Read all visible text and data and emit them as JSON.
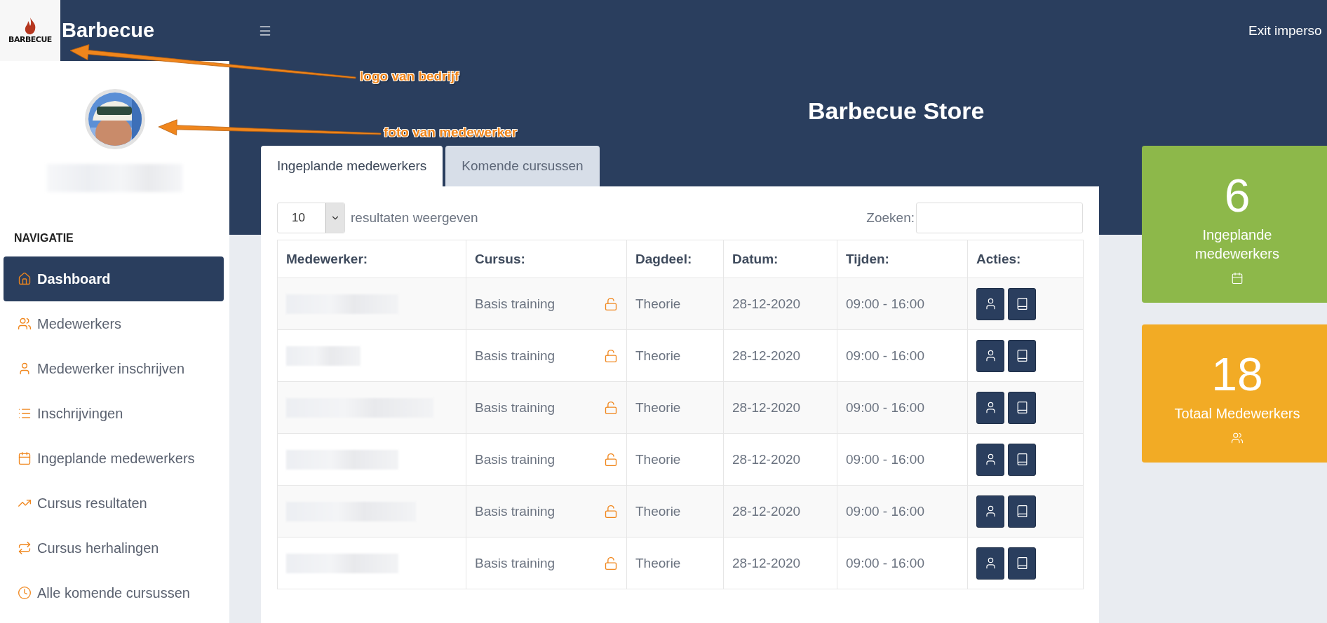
{
  "topbar": {
    "logo_text": "BARBECUE",
    "brand": "Barbecue",
    "exit_link": "Exit imperso"
  },
  "annotations": [
    {
      "label": "logo van bedrijf"
    },
    {
      "label": "foto van medewerker"
    }
  ],
  "sidebar": {
    "section_title": "NAVIGATIE",
    "items": [
      {
        "label": "Dashboard",
        "kind": "home",
        "selected": true
      },
      {
        "label": "Medewerkers",
        "kind": "users",
        "selected": false
      },
      {
        "label": "Medewerker inschrijven",
        "kind": "user",
        "selected": false
      },
      {
        "label": "Inschrijvingen",
        "kind": "list",
        "selected": false
      },
      {
        "label": "Ingeplande medewerkers",
        "kind": "calendar",
        "selected": false
      },
      {
        "label": "Cursus resultaten",
        "kind": "chart",
        "selected": false
      },
      {
        "label": "Cursus herhalingen",
        "kind": "repeat",
        "selected": false
      },
      {
        "label": "Alle komende cursussen",
        "kind": "clock",
        "selected": false
      }
    ]
  },
  "page_title": "Barbecue Store",
  "tabs": [
    {
      "label": "Ingeplande medewerkers",
      "selected": true
    },
    {
      "label": "Komende cursussen",
      "selected": false
    }
  ],
  "table_controls": {
    "page_size": "10",
    "page_size_suffix": "resultaten weergeven",
    "search_label": "Zoeken:"
  },
  "table": {
    "columns": [
      "Medewerker:",
      "Cursus:",
      "Dagdeel:",
      "Datum:",
      "Tijden:",
      "Acties:"
    ],
    "rows": [
      {
        "course": "Basis training",
        "part": "Theorie",
        "date": "28-12-2020",
        "times": "09:00 - 16:00"
      },
      {
        "course": "Basis training",
        "part": "Theorie",
        "date": "28-12-2020",
        "times": "09:00 - 16:00"
      },
      {
        "course": "Basis training",
        "part": "Theorie",
        "date": "28-12-2020",
        "times": "09:00 - 16:00"
      },
      {
        "course": "Basis training",
        "part": "Theorie",
        "date": "28-12-2020",
        "times": "09:00 - 16:00"
      },
      {
        "course": "Basis training",
        "part": "Theorie",
        "date": "28-12-2020",
        "times": "09:00 - 16:00"
      },
      {
        "course": "Basis training",
        "part": "Theorie",
        "date": "28-12-2020",
        "times": "09:00 - 16:00"
      }
    ]
  },
  "stats": [
    {
      "value": "6",
      "label": "Ingeplande medewerkers",
      "color": "#8db84a",
      "kind": "calendar"
    },
    {
      "value": "18",
      "label": "Totaal Medewerkers",
      "color": "#f2ab25",
      "kind": "users"
    }
  ]
}
